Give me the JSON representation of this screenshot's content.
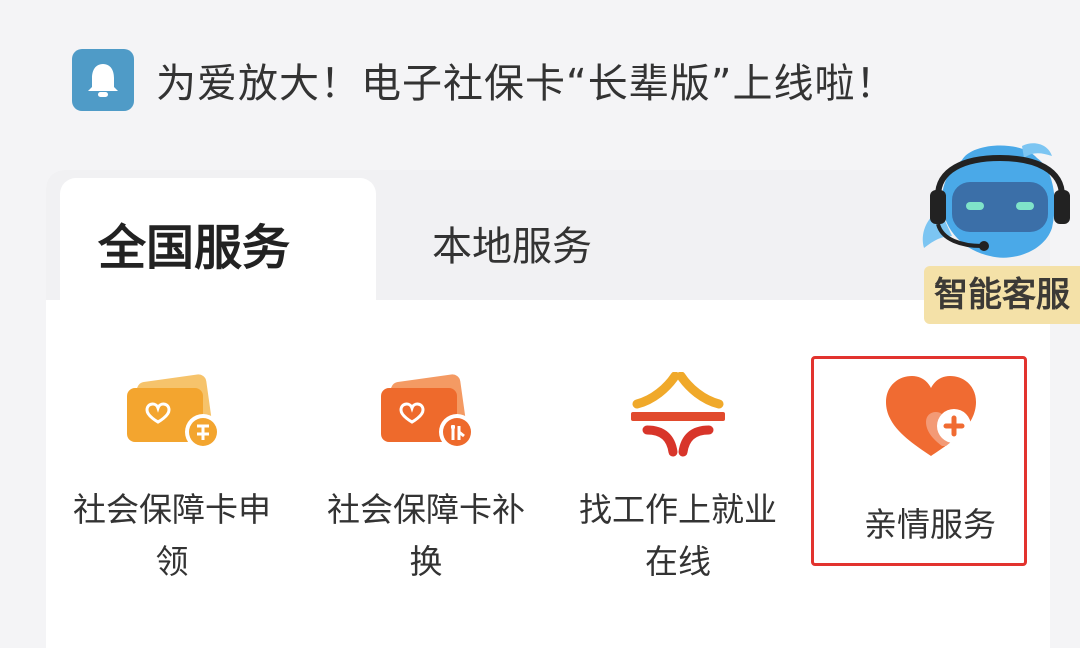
{
  "notice": {
    "icon": "bell-icon",
    "text": "为爱放大！电子社保卡“长辈版”上线啦！"
  },
  "tabs": [
    {
      "label": "全国服务",
      "active": true
    },
    {
      "label": "本地服务",
      "active": false
    }
  ],
  "customer_service": {
    "label": "智能客服",
    "icon": "robot-mascot-icon"
  },
  "services": [
    {
      "label_line1": "社会保障卡申",
      "label_line2": "领",
      "icon": "card-apply-icon"
    },
    {
      "label_line1": "社会保障卡补",
      "label_line2": "换",
      "icon": "card-replace-icon"
    },
    {
      "label_line1": "找工作上就业",
      "label_line2": "在线",
      "icon": "job-search-icon"
    },
    {
      "label": "亲情服务",
      "icon": "family-service-icon"
    }
  ],
  "colors": {
    "highlight": "#e2332e",
    "accent_orange": "#f07a2a",
    "notice_icon": "#4f9bc7"
  }
}
